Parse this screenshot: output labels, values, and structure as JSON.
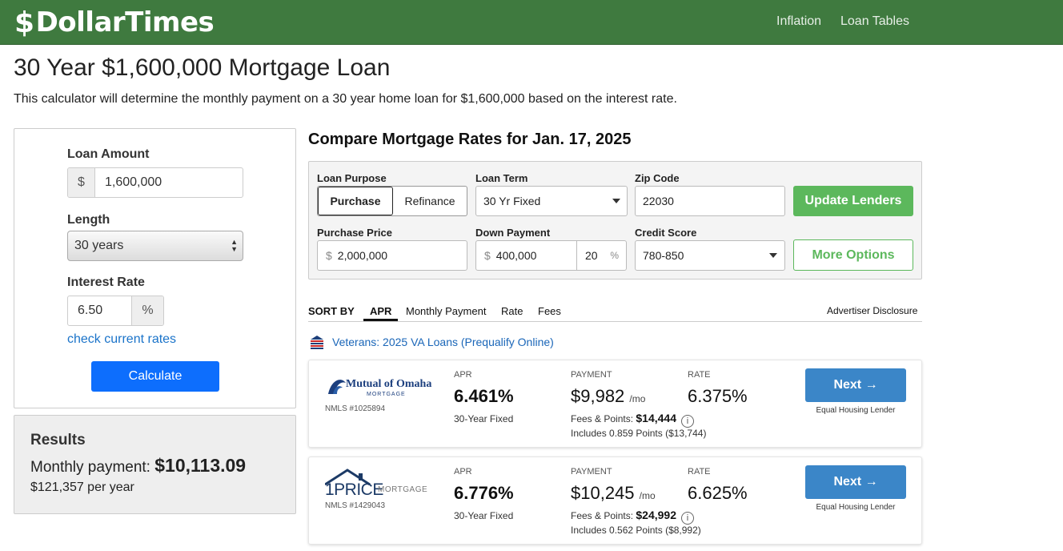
{
  "header": {
    "brand": "DollarTimes",
    "nav": [
      "Inflation",
      "Loan Tables"
    ],
    "bg_color": "#3f7a3f"
  },
  "page": {
    "title": "30 Year $1,600,000 Mortgage Loan",
    "subtitle": "This calculator will determine the monthly payment on a 30 year home loan for $1,600,000 based on the interest rate."
  },
  "calculator": {
    "loan_amount_label": "Loan Amount",
    "loan_amount_prefix": "$",
    "loan_amount_value": "1,600,000",
    "length_label": "Length",
    "length_value": "30 years",
    "interest_label": "Interest Rate",
    "interest_value": "6.50",
    "interest_suffix": "%",
    "check_rates_link": "check current rates",
    "calculate_button": "Calculate",
    "button_color": "#0d6efd"
  },
  "results": {
    "title": "Results",
    "monthly_label": "Monthly payment:",
    "monthly_value": "$10,113.09",
    "yearly": "$121,357 per year"
  },
  "compare": {
    "title": "Compare Mortgage Rates for Jan. 17, 2025",
    "loan_purpose_label": "Loan Purpose",
    "purpose_options": [
      "Purchase",
      "Refinance"
    ],
    "purpose_selected": "Purchase",
    "loan_term_label": "Loan Term",
    "loan_term_value": "30 Yr Fixed",
    "zip_label": "Zip Code",
    "zip_value": "22030",
    "update_button": "Update Lenders",
    "purchase_price_label": "Purchase Price",
    "purchase_price_prefix": "$",
    "purchase_price_value": "2,000,000",
    "down_payment_label": "Down Payment",
    "down_payment_prefix": "$",
    "down_payment_value": "400,000",
    "down_payment_pct": "20",
    "down_payment_pct_suffix": "%",
    "credit_label": "Credit Score",
    "credit_value": "780-850",
    "more_options_button": "More Options",
    "green_color": "#5cb85c"
  },
  "sort": {
    "label": "SORT BY",
    "options": [
      "APR",
      "Monthly Payment",
      "Rate",
      "Fees"
    ],
    "active": "APR",
    "disclosure": "Advertiser Disclosure"
  },
  "va_banner": "Veterans: 2025 VA Loans (Prequalify Online)",
  "lenders": [
    {
      "logo_text": "Mutual of Omaha",
      "logo_sub": "MORTGAGE",
      "nmls": "NMLS #1025894",
      "apr_label": "APR",
      "apr": "6.461%",
      "term": "30-Year Fixed",
      "payment_label": "PAYMENT",
      "payment": "$9,982",
      "payment_unit": "/mo",
      "fees_label": "Fees & Points:",
      "fees_value": "$14,444",
      "points_note": "Includes 0.859 Points ($13,744)",
      "rate_label": "RATE",
      "rate": "6.375%",
      "next_button": "Next →",
      "ehl": "Equal Housing Lender"
    },
    {
      "logo_text": "1PRICE",
      "logo_sub": "MORTGAGE",
      "nmls": "NMLS #1429043",
      "apr_label": "APR",
      "apr": "6.776%",
      "term": "30-Year Fixed",
      "payment_label": "PAYMENT",
      "payment": "$10,245",
      "payment_unit": "/mo",
      "fees_label": "Fees & Points:",
      "fees_value": "$24,992",
      "points_note": "Includes 0.562 Points ($8,992)",
      "rate_label": "RATE",
      "rate": "6.625%",
      "next_button": "Next →",
      "ehl": "Equal Housing Lender"
    }
  ]
}
